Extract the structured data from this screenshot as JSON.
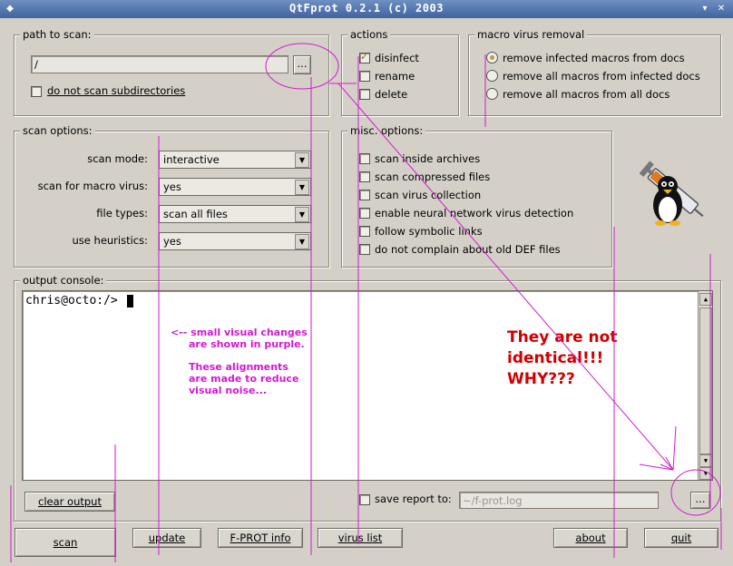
{
  "window": {
    "title": "QtFprot 0.2.1 (c) 2003"
  },
  "path_group": {
    "legend": "path to scan:",
    "path_value": "/",
    "browse_label": "...",
    "no_subdirs_label": "do not scan subdirectories"
  },
  "actions_group": {
    "legend": "actions",
    "items": [
      {
        "label": "disinfect",
        "checked": true
      },
      {
        "label": "rename",
        "checked": false
      },
      {
        "label": "delete",
        "checked": false
      }
    ]
  },
  "macro_group": {
    "legend": "macro virus removal",
    "options": [
      {
        "label": "remove infected macros from docs",
        "selected": true
      },
      {
        "label": "remove all macros from infected docs",
        "selected": false
      },
      {
        "label": "remove all macros from all docs",
        "selected": false
      }
    ]
  },
  "scan_options": {
    "legend": "scan options:",
    "rows": [
      {
        "label": "scan mode:",
        "value": "interactive"
      },
      {
        "label": "scan for macro virus:",
        "value": "yes"
      },
      {
        "label": "file types:",
        "value": "scan all files"
      },
      {
        "label": "use heuristics:",
        "value": "yes"
      }
    ]
  },
  "misc_options": {
    "legend": "misc. options:",
    "items": [
      "scan inside archives",
      "scan compressed files",
      "scan virus collection",
      "enable neural network virus detection",
      "follow symbolic links",
      "do not complain about old DEF files"
    ]
  },
  "console": {
    "legend": "output console:",
    "prompt": "chris@octo:/>",
    "clear_label": "clear output",
    "save_report_label": "save report to:",
    "report_path_placeholder": "~/f-prot.log",
    "report_browse_label": "..."
  },
  "bottom_buttons": {
    "scan": "scan",
    "update": "update",
    "fprot_info": "F-PROT info",
    "virus_list": "virus list",
    "about": "about",
    "quit": "quit"
  },
  "annotations": {
    "purple_line1": "<-- small visual changes",
    "purple_line2": "are shown in purple.",
    "purple_line3": "These alignments",
    "purple_line4": "are made to reduce",
    "purple_line5": "visual noise...",
    "red_line1": "They are not",
    "red_line2": "identical!!!",
    "red_line3": "WHY???"
  },
  "colors": {
    "annotation_purple": "#d21ad2",
    "annotation_red": "#d00000",
    "titlebar": "#4a6ea8"
  },
  "icons": [
    "penguin-syringe-logo-icon",
    "window-menu-icon",
    "minimize-icon",
    "close-icon"
  ]
}
